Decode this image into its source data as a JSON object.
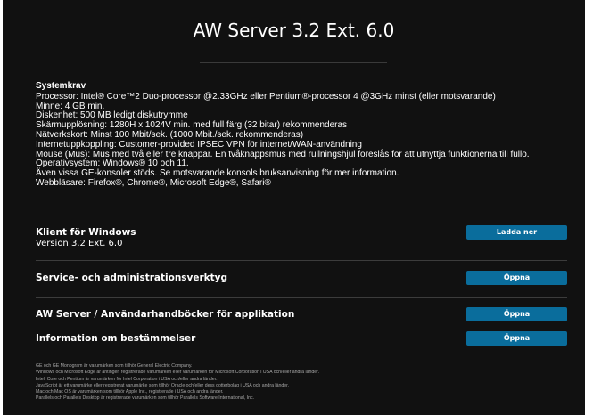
{
  "title": "AW Server 3.2 Ext. 6.0",
  "system_requirements": {
    "heading": "Systemkrav",
    "lines": [
      "Processor: Intel® Core™2 Duo-processor @2.33GHz eller Pentium®-processor 4 @3GHz minst (eller motsvarande)",
      "Minne: 4 GB min.",
      "Diskenhet: 500 MB ledigt diskutrymme",
      "Skärmupplösning: 1280H x 1024V min. med full färg (32 bitar) rekommenderas",
      "Nätverkskort: Minst 100 Mbit/sek. (1000 Mbit./sek. rekommenderas)",
      "Internetuppkoppling: Customer-provided IPSEC VPN för internet/WAN-användning",
      "Mouse (Mus): Mus med två eller tre knappar. En tvåknappsmus med rullningshjul föreslås för att utnyttja funktionerna till fullo.",
      "Operativsystem: Windows® 10 och 11.",
      "Även vissa GE-konsoler stöds. Se motsvarande konsols bruksanvisning för mer information.",
      "Webbläsare: Firefox®, Chrome®, Microsoft Edge®, Safari®"
    ]
  },
  "rows": [
    {
      "title": "Klient för Windows",
      "subtitle": "Version 3.2 Ext. 6.0",
      "button": "Ladda ner"
    },
    {
      "title": "Service- och administrationsverktyg",
      "button": "Öppna"
    },
    {
      "title": "AW Server / Användarhandböcker för applikation",
      "button": "Öppna"
    },
    {
      "title": "Information om bestämmelser",
      "button": "Öppna"
    }
  ],
  "footer": [
    "GE och GE Monogram är varumärken som tillhör General Electric Company.",
    "Windows och Microsoft Edge är antingen registrerade varumärken eller varumärken för Microsoft Corporation i USA och/eller andra länder.",
    "Intel, Core och Pentium är varumärken för Intel Corporation i USA och/eller andra länder.",
    "JavaScript är ett varumärke eller registrerat varumärke som tillhör Oracle och/eller dess dotterbolag i USA och andra länder.",
    "Mac och Mac OS är varumärken som tillhör Apple Inc., registrerade i USA och andra länder.",
    "Parallels och Parallels Desktop är registrerade varumärken som tillhör Parallels Software International, Inc."
  ],
  "colors": {
    "background": "#111111",
    "button": "#0a6d9c",
    "divider": "#3c3c3c"
  }
}
